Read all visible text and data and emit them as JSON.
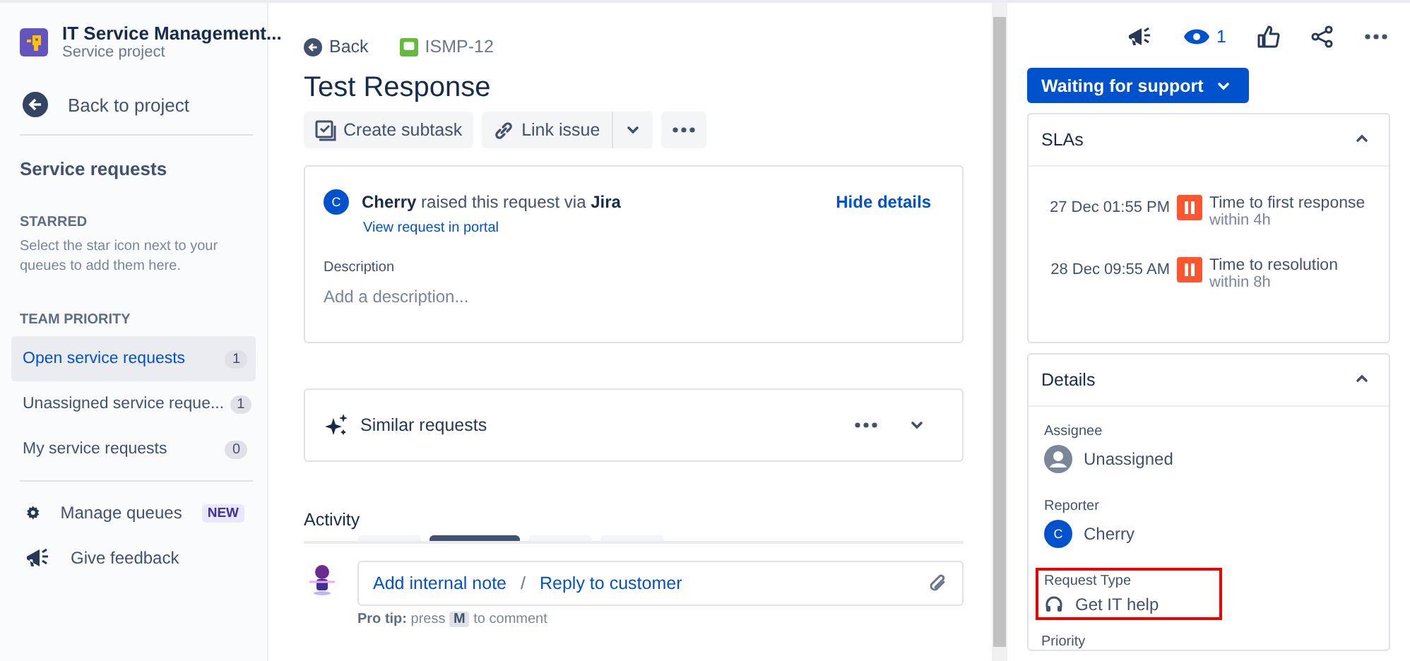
{
  "sidebar": {
    "project": {
      "name": "IT Service Management...",
      "type": "Service project"
    },
    "back_link": "Back to project",
    "section_title": "Service requests",
    "starred": {
      "heading": "STARRED",
      "hint": "Select the star icon next to your queues to add them here."
    },
    "team_priority": {
      "heading": "TEAM PRIORITY",
      "queues": [
        {
          "label": "Open service requests",
          "count": "1",
          "selected": true
        },
        {
          "label": "Unassigned service reque...",
          "count": "1",
          "selected": false
        },
        {
          "label": "My service requests",
          "count": "0",
          "selected": false
        }
      ]
    },
    "footer_items": [
      {
        "kind": "settings",
        "label": "Manage queues",
        "badge": "NEW"
      },
      {
        "kind": "feedback",
        "label": "Give feedback"
      }
    ]
  },
  "issue": {
    "back": "Back",
    "key": "ISMP-12",
    "title": "Test Response",
    "actions": [
      {
        "kind": "subtask",
        "label": "Create subtask"
      },
      {
        "kind": "link",
        "label": "Link issue"
      }
    ],
    "request": {
      "initial": "C",
      "raised": "**Cherry** raised this request via **Jira**",
      "hide_details": "Hide details",
      "portal_link": "View request in portal",
      "description_label": "Description",
      "description_placeholder": "Add a description..."
    },
    "similar": {
      "title": "Similar requests"
    },
    "activity": {
      "title": "Activity",
      "tabs": [
        {
          "selected": false
        },
        {
          "selected": true
        },
        {
          "selected": false
        },
        {
          "selected": false
        }
      ]
    },
    "comment": {
      "internal_note": "Add internal note",
      "separator": "/",
      "reply": "Reply to customer",
      "pro_tip": "**Pro tip:** press",
      "key": "M",
      "suffix": "to comment"
    }
  },
  "side_panel": {
    "watchers": "1",
    "status": "Waiting for support",
    "slas": {
      "title": "SLAs",
      "expanded": true,
      "items": [
        {
          "time": "27 Dec 01:55 PM",
          "goal": "Time to first response",
          "within": "within 4h"
        },
        {
          "time": "28 Dec 09:55 AM",
          "goal": "Time to resolution",
          "within": "within 8h"
        }
      ]
    },
    "details": {
      "title": "Details",
      "expanded": true,
      "fields": [
        {
          "kind": "assignee",
          "label": "Assignee",
          "value": "Unassigned",
          "highlighted": false
        },
        {
          "kind": "reporter",
          "label": "Reporter",
          "value": "Cherry",
          "initial": "C",
          "highlighted": false
        },
        {
          "kind": "request_type",
          "label": "Request Type",
          "value": "Get IT help",
          "highlighted": true
        }
      ],
      "next_label": "Priority"
    }
  }
}
